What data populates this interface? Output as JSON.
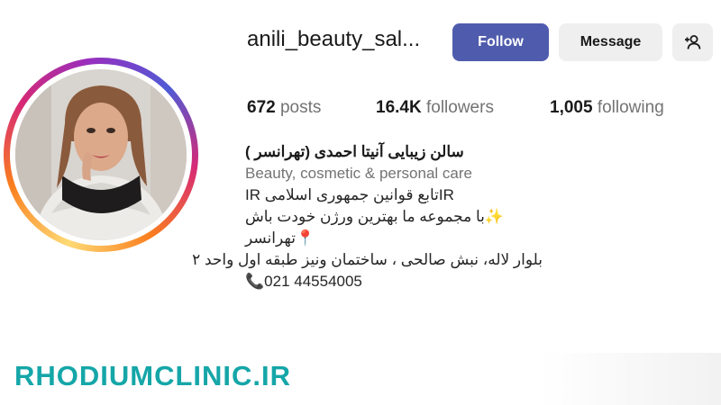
{
  "profile": {
    "username": "anili_beauty_sal...",
    "follow_label": "Follow",
    "message_label": "Message",
    "add_user_icon": "add-user-icon"
  },
  "stats": {
    "posts_count": "672",
    "posts_label": "posts",
    "followers_count": "16.4K",
    "followers_label": "followers",
    "following_count": "1,005",
    "following_label": "following"
  },
  "bio": {
    "name": "سالن زیبایی آنیتا احمدی (تهرانسر )",
    "category": "Beauty, cosmetic & personal care",
    "line1": "IR تابع قوانین جمهوری اسلامیIR",
    "line2": "✨با مجموعه ما بهترین ورژن خودت باش",
    "line3": "📍تهرانسر",
    "line4": "بلوار لاله، نبش صالحی ، ساختمان ونیز طبقه اول واحد ۲",
    "line5": "📞021 44554005"
  },
  "watermark": "RHODIUMCLINIC.IR",
  "colors": {
    "follow_button": "#4f5cad",
    "secondary_button": "#efefef",
    "muted_text": "#737373",
    "watermark": "#15a6a8"
  }
}
